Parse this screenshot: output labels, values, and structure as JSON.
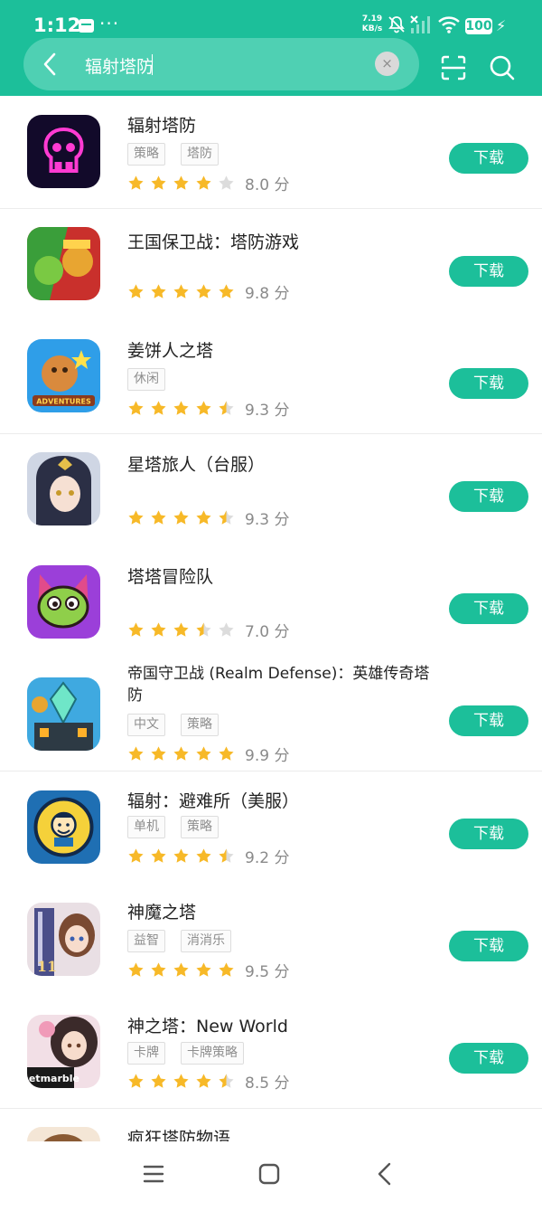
{
  "status_bar": {
    "time": "1:12",
    "more": "···",
    "speed_value": "7.19",
    "speed_unit": "KB/s",
    "battery": "100"
  },
  "search": {
    "query": "辐射塔防",
    "clear_label": "×"
  },
  "apps": [
    {
      "name": "辐射塔防",
      "tags": [
        "策略",
        "塔防"
      ],
      "rating": 4,
      "score": "8.0 分",
      "button": "下载"
    },
    {
      "name": "王国保卫战：塔防游戏",
      "tags": [],
      "rating": 5,
      "score": "9.8 分",
      "button": "下载"
    },
    {
      "name": "姜饼人之塔",
      "tags": [
        "休闲"
      ],
      "rating": 4.5,
      "score": "9.3 分",
      "button": "下载"
    },
    {
      "name": "星塔旅人（台服）",
      "tags": [],
      "rating": 4.5,
      "score": "9.3 分",
      "button": "下载"
    },
    {
      "name": "塔塔冒险队",
      "tags": [],
      "rating": 3.5,
      "score": "7.0 分",
      "button": "下载"
    },
    {
      "name": "帝国守卫战 (Realm Defense)：英雄传奇塔防",
      "tags": [
        "中文",
        "策略"
      ],
      "rating": 5,
      "score": "9.9 分",
      "button": "下载"
    },
    {
      "name": "辐射：避难所（美服）",
      "tags": [
        "单机",
        "策略"
      ],
      "rating": 4.5,
      "score": "9.2 分",
      "button": "下载"
    },
    {
      "name": "神魔之塔",
      "tags": [
        "益智",
        "消消乐"
      ],
      "rating": 5,
      "score": "9.5 分",
      "button": "下载"
    },
    {
      "name": "神之塔：New World",
      "tags": [
        "卡牌",
        "卡牌策略"
      ],
      "rating": 4.5,
      "score": "8.5 分",
      "button": "下载"
    },
    {
      "name": "疯狂塔防物语",
      "tags": [],
      "rating": 0,
      "score": "",
      "button": ""
    }
  ],
  "colors": {
    "accent": "#1cbf9a",
    "star": "#f7b928",
    "star_empty": "#dcdcdc"
  }
}
